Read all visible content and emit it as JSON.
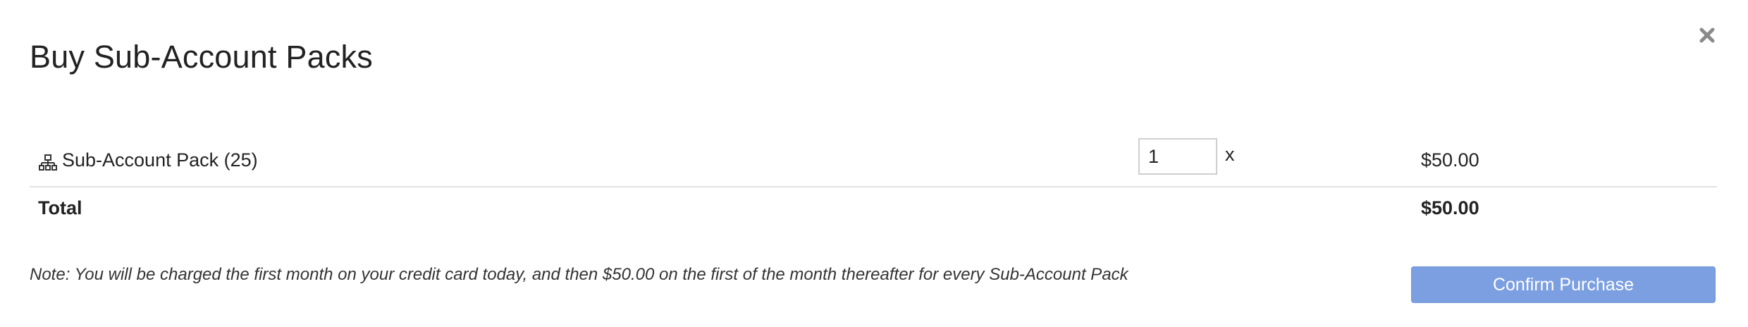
{
  "dialog": {
    "title": "Buy Sub-Account Packs",
    "close_icon": "close-icon"
  },
  "line_item": {
    "icon": "sitemap-icon",
    "label": "Sub-Account Pack (25)",
    "quantity": "1",
    "multiplier": "x",
    "price": "$50.00"
  },
  "total": {
    "label": "Total",
    "value": "$50.00"
  },
  "note": "Note: You will be charged the first month on your credit card today, and then $50.00 on the first of the month thereafter for every Sub-Account Pack",
  "confirm_button": {
    "label": "Confirm Purchase",
    "color": "#7b9fe0"
  }
}
